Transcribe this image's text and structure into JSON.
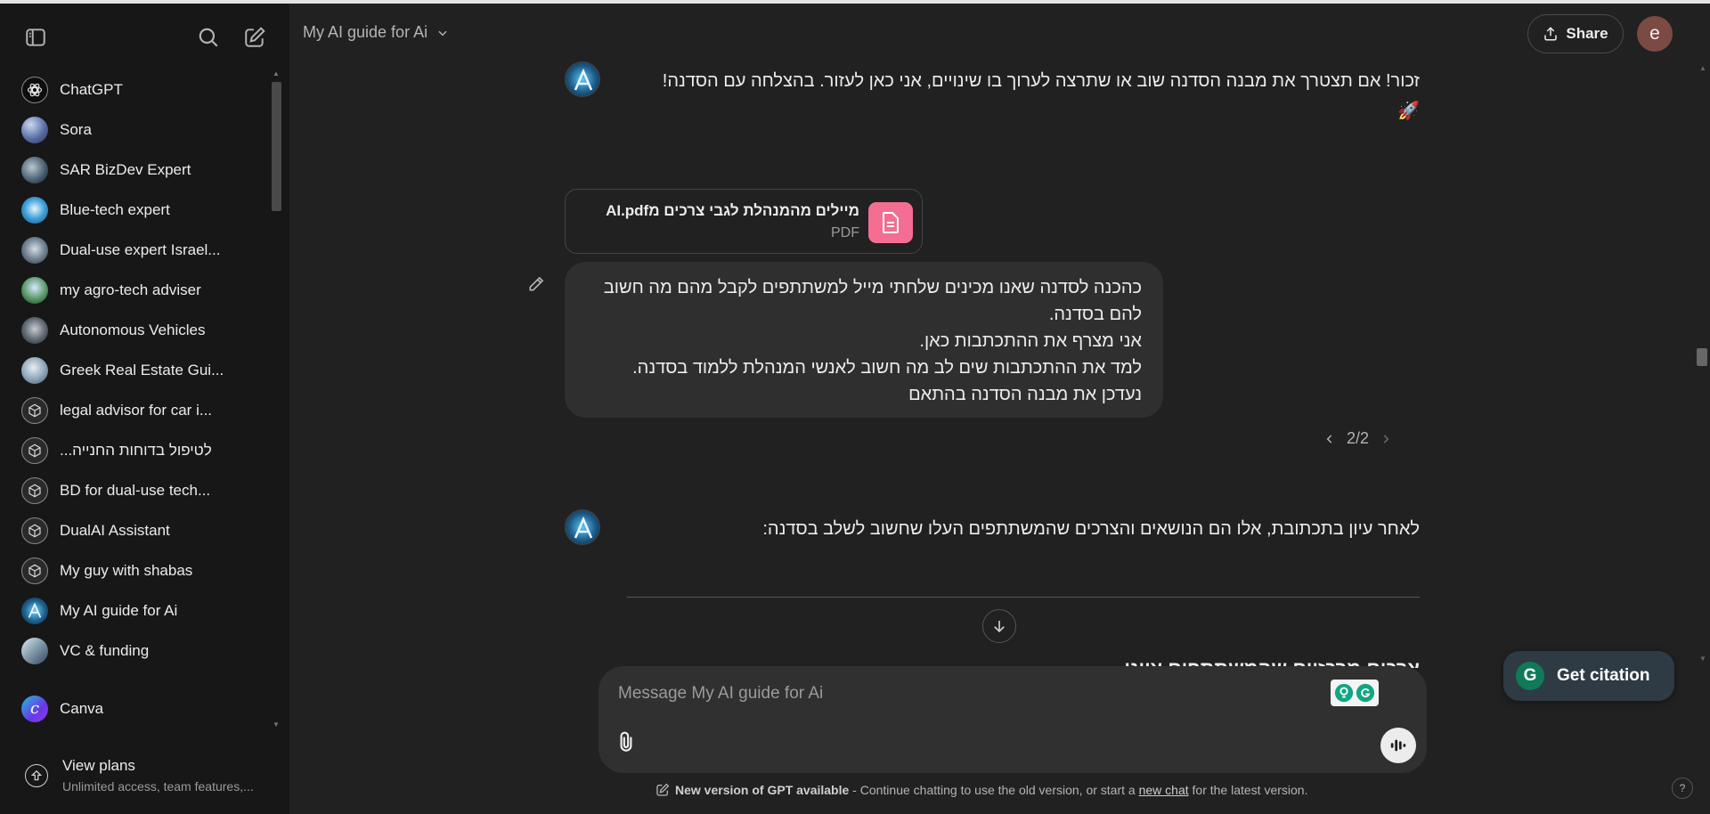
{
  "sidebar": {
    "items": [
      {
        "label": "ChatGPT",
        "icon": "chatgpt-icon"
      },
      {
        "label": "Sora",
        "icon": "sora-icon"
      },
      {
        "label": "SAR BizDev Expert",
        "icon": "gpt-avatar"
      },
      {
        "label": "Blue-tech expert",
        "icon": "gpt-avatar"
      },
      {
        "label": "Dual-use expert Israel...",
        "icon": "gpt-avatar"
      },
      {
        "label": "my agro-tech adviser",
        "icon": "gpt-avatar"
      },
      {
        "label": "Autonomous Vehicles",
        "icon": "gpt-avatar"
      },
      {
        "label": "Greek Real Estate Gui...",
        "icon": "gpt-avatar"
      },
      {
        "label": "legal advisor for car i...",
        "icon": "cube-icon"
      },
      {
        "label": "לטיפול בדוחות החנייה...",
        "icon": "cube-icon"
      },
      {
        "label": "BD for dual-use tech...",
        "icon": "cube-icon"
      },
      {
        "label": "DualAI Assistant",
        "icon": "cube-icon"
      },
      {
        "label": "My guy with shabas",
        "icon": "cube-icon"
      },
      {
        "label": "My AI guide for Ai",
        "icon": "gpt-avatar"
      },
      {
        "label": "VC & funding",
        "icon": "gpt-avatar"
      }
    ],
    "canva": "Canva",
    "plans_title": "View plans",
    "plans_sub": "Unlimited access, team features,..."
  },
  "header": {
    "model": "My AI guide for Ai",
    "share": "Share",
    "user_initial": "e"
  },
  "conversation": {
    "msg1_line1": "זכור! אם תצטרך את מבנה הסדנה שוב או שתרצה לערוך בו שינויים, אני כאן לעזור. בהצלחה עם הסדנה!",
    "msg1_emoji": "🚀",
    "file_name": "מיילים מהמנהלת לגבי צרכים מAI.pdf",
    "file_type": "PDF",
    "user_lines": [
      "כהכנה לסדנה שאנו מכינים שלחתי מייל למשתתפים לקבל מהם מה חשוב",
      "להם בסדנה.",
      "אני מצרף את ההתכתבות כאן.",
      "למד את ההתכתבות שים לב מה חשוב לאנשי המנהלת ללמוד בסדנה.",
      "נעדכן את מבנה הסדנה בהתאם"
    ],
    "pager": "2/2",
    "msg2": "לאחר עיון בתכתובת, אלו הם הנושאים והצרכים שהמשתתפים העלו שחשוב לשלב בסדנה:",
    "peek_heading": "צרכים מרכזיים שהמשתתפים ציינו"
  },
  "composer": {
    "placeholder": "Message My AI guide for Ai"
  },
  "citation": {
    "label": "Get citation",
    "logo_letter": "G"
  },
  "notice": {
    "bold": "New version of GPT available",
    "text": " - Continue chatting to use the old version, or start a ",
    "link": "new chat",
    "tail": " for the latest version."
  },
  "help": "?",
  "colors": {
    "background": "#212121",
    "sidebar": "#171717",
    "bubble": "#2f2f2f",
    "pdf_icon": "#f46e92",
    "avatar": "#7b4a42"
  }
}
